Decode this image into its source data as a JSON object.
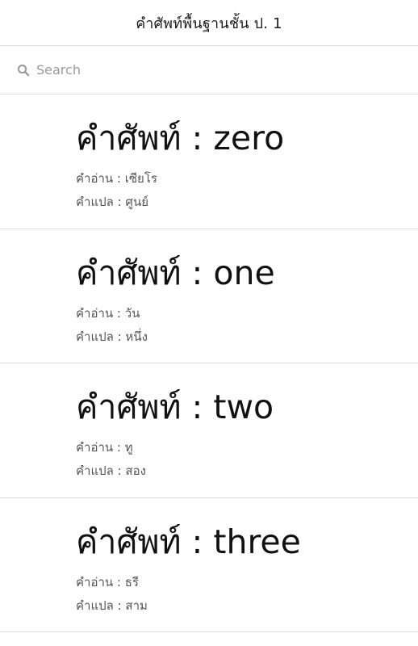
{
  "header": {
    "title": "คำศัพท์พื้นฐานชั้น ป. 1"
  },
  "search": {
    "placeholder": "Search",
    "icon": "search-icon"
  },
  "items": [
    {
      "word_line": "คำศัพท์ : zero",
      "reading_line": "คำอ่าน : เซียโร",
      "meaning_line": "คำแปล : ศูนย์"
    },
    {
      "word_line": "คำศัพท์ : one",
      "reading_line": "คำอ่าน : วัน",
      "meaning_line": "คำแปล : หนึ่ง"
    },
    {
      "word_line": "คำศัพท์ : two",
      "reading_line": "คำอ่าน : ทู",
      "meaning_line": "คำแปล : สอง"
    },
    {
      "word_line": "คำศัพท์ : three",
      "reading_line": "คำอ่าน : ธรี",
      "meaning_line": "คำแปล : สาม"
    }
  ]
}
